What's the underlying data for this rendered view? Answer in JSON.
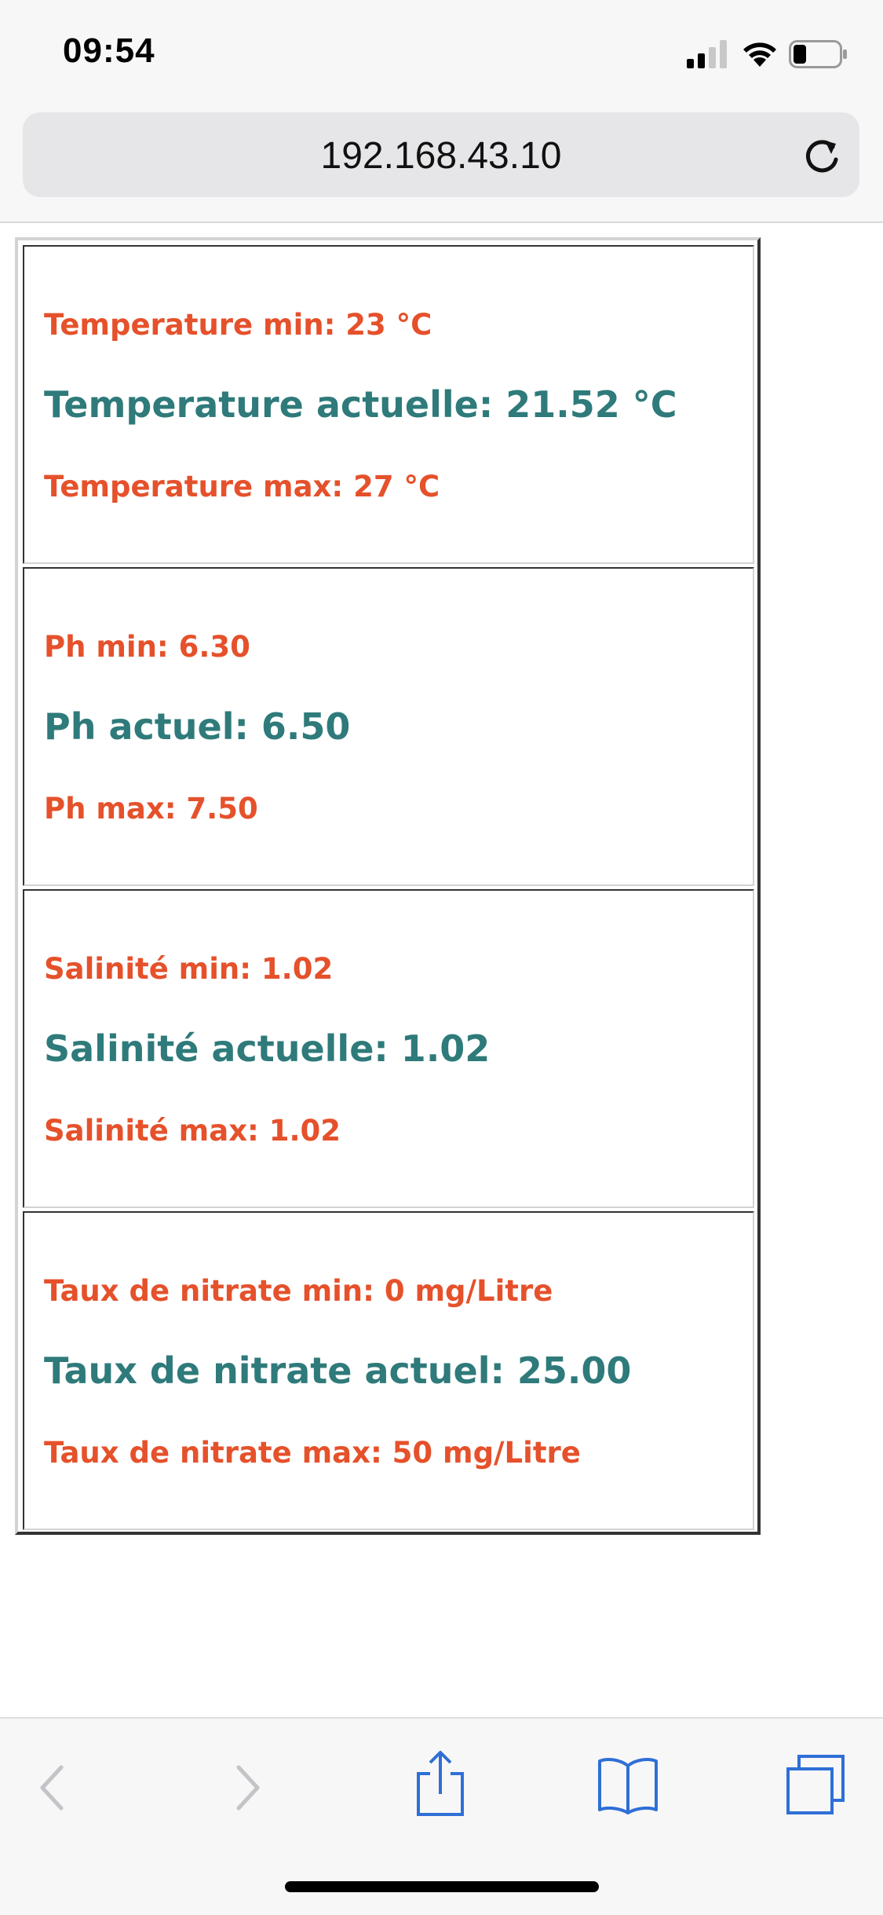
{
  "status_bar": {
    "time": "09:54",
    "icons": [
      "signal-icon",
      "wifi-icon",
      "battery-icon"
    ]
  },
  "browser": {
    "url": "192.168.43.10",
    "reload_icon": "reload-icon"
  },
  "readings": [
    {
      "min_text": "Temperature min: 23 °C",
      "current_text": "Temperature actuelle: 21.52 °C",
      "max_text": "Temperature max: 27 °C"
    },
    {
      "min_text": "Ph min: 6.30",
      "current_text": "Ph actuel: 6.50",
      "max_text": "Ph max: 7.50"
    },
    {
      "min_text": "Salinité min: 1.02",
      "current_text": "Salinité actuelle: 1.02",
      "max_text": "Salinité max: 1.02"
    },
    {
      "min_text": "Taux de nitrate min: 0 mg/Litre",
      "current_text": "Taux de nitrate actuel: 25.00",
      "max_text": "Taux de nitrate max: 50 mg/Litre"
    }
  ],
  "toolbar": {
    "icons": [
      "back-icon",
      "forward-icon",
      "share-icon",
      "bookmarks-icon",
      "tabs-icon"
    ]
  },
  "colors": {
    "min_max_text": "#e5512b",
    "current_text": "#2f7a7a",
    "toolbar_icon": "#2f6fd6",
    "toolbar_icon_disabled": "#c4c4c8"
  }
}
